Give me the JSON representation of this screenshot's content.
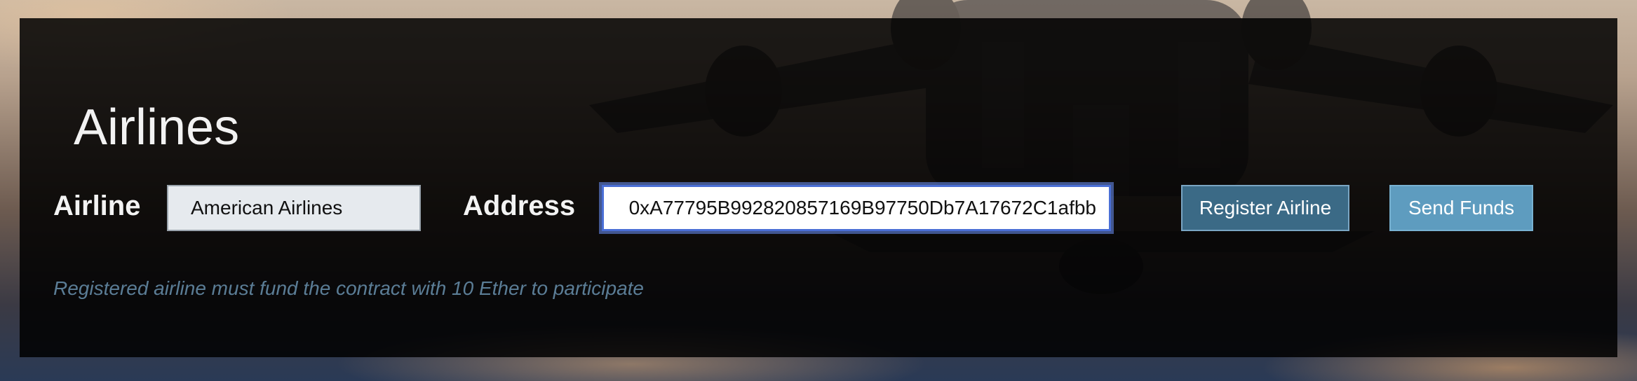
{
  "section": {
    "title": "Airlines"
  },
  "form": {
    "airline_label": "Airline",
    "airline_value": "American Airlines",
    "address_label": "Address",
    "address_value": "0xA77795B992820857169B97750Db7A17672C1afbb"
  },
  "actions": {
    "register_label": "Register Airline",
    "send_funds_label": "Send Funds"
  },
  "note": {
    "text": "Registered airline must fund the contract with 10 Ether to participate"
  },
  "colors": {
    "panel_bg": "#000000",
    "register_button": "#3b6a86",
    "send_funds_button": "#5e9cbf",
    "note_text": "#5b7d96",
    "focus_ring": "#4a6fd6"
  },
  "icons": {
    "background": "airplane-takeoff-photo"
  }
}
